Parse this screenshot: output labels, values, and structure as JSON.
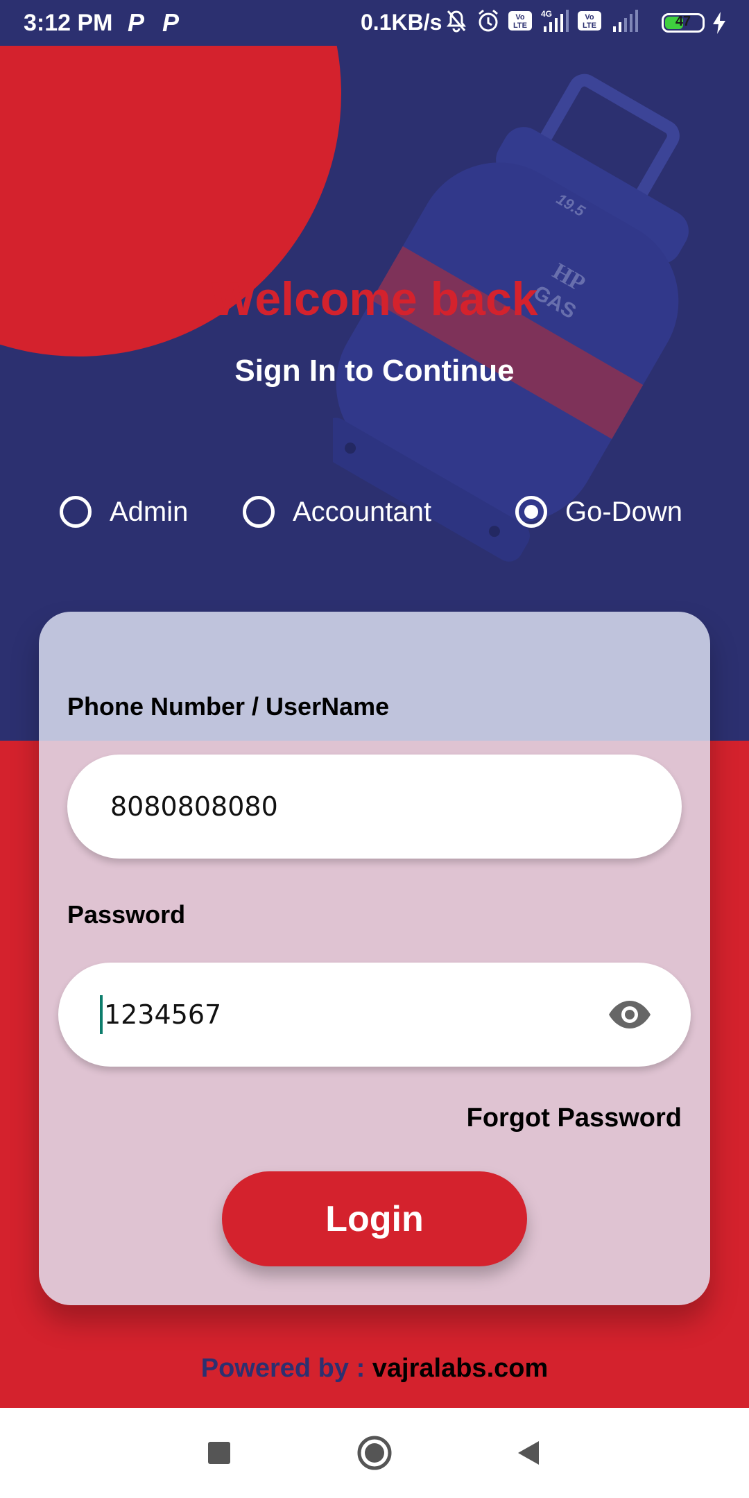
{
  "status_bar": {
    "time": "3:12 PM",
    "app_icon_1": "P",
    "app_icon_2": "P",
    "net_speed": "0.1KB/s",
    "icons": [
      "mute-icon",
      "alarm-icon",
      "volte-icon",
      "signal-icon",
      "volte-icon",
      "signal-icon"
    ],
    "network_type": "4G",
    "volte_label": "Vo LTE",
    "battery_level": "47",
    "battery_charging": true
  },
  "header": {
    "welcome": "Welcome back",
    "subtitle": "Sign In to Continue"
  },
  "roles": [
    {
      "label": "Admin",
      "selected": false
    },
    {
      "label": "Accountant",
      "selected": false
    },
    {
      "label": "Go-Down",
      "selected": true
    }
  ],
  "form": {
    "username_label": "Phone Number / UserName",
    "username_value": "8080808080",
    "password_label": "Password",
    "password_value": "1234567",
    "forgot_label": "Forgot Password",
    "login_label": "Login"
  },
  "footer": {
    "powered_by": "Powered by :",
    "site": "vajralabs.com"
  },
  "illustration": {
    "brand_top": "HP",
    "brand_bottom": "GAS",
    "weight": "19.5"
  },
  "colors": {
    "navy": "#2c3070",
    "red": "#d4222d",
    "card_top": "#bfc3dc",
    "card_bottom": "#dfc3d2",
    "caret": "#0d7d6c"
  },
  "nav_bar": [
    "recents-icon",
    "home-icon",
    "back-icon"
  ]
}
